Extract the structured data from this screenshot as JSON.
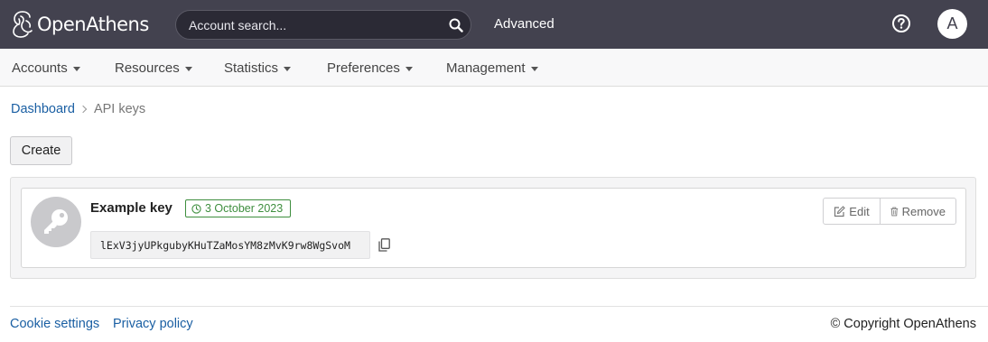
{
  "header": {
    "brand": "OpenAthens",
    "search_placeholder": "Account search...",
    "advanced_label": "Advanced",
    "avatar_initial": "A"
  },
  "nav": {
    "items": [
      {
        "label": "Accounts"
      },
      {
        "label": "Resources"
      },
      {
        "label": "Statistics"
      },
      {
        "label": "Preferences"
      },
      {
        "label": "Management"
      }
    ]
  },
  "breadcrumb": {
    "home": "Dashboard",
    "current": "API keys"
  },
  "actions": {
    "create_label": "Create"
  },
  "api_key": {
    "name": "Example key",
    "date": "3 October 2023",
    "value": "lExV3jyUPkgubyKHuTZaMosYM8zMvK9rw8WgSvoM",
    "edit_label": "Edit",
    "remove_label": "Remove"
  },
  "footer": {
    "cookie_label": "Cookie settings",
    "privacy_label": "Privacy policy",
    "copyright": "© Copyright OpenAthens"
  },
  "colors": {
    "header_bg": "#43424f",
    "link": "#1a5fa3",
    "badge_green": "#3e8e3e"
  }
}
